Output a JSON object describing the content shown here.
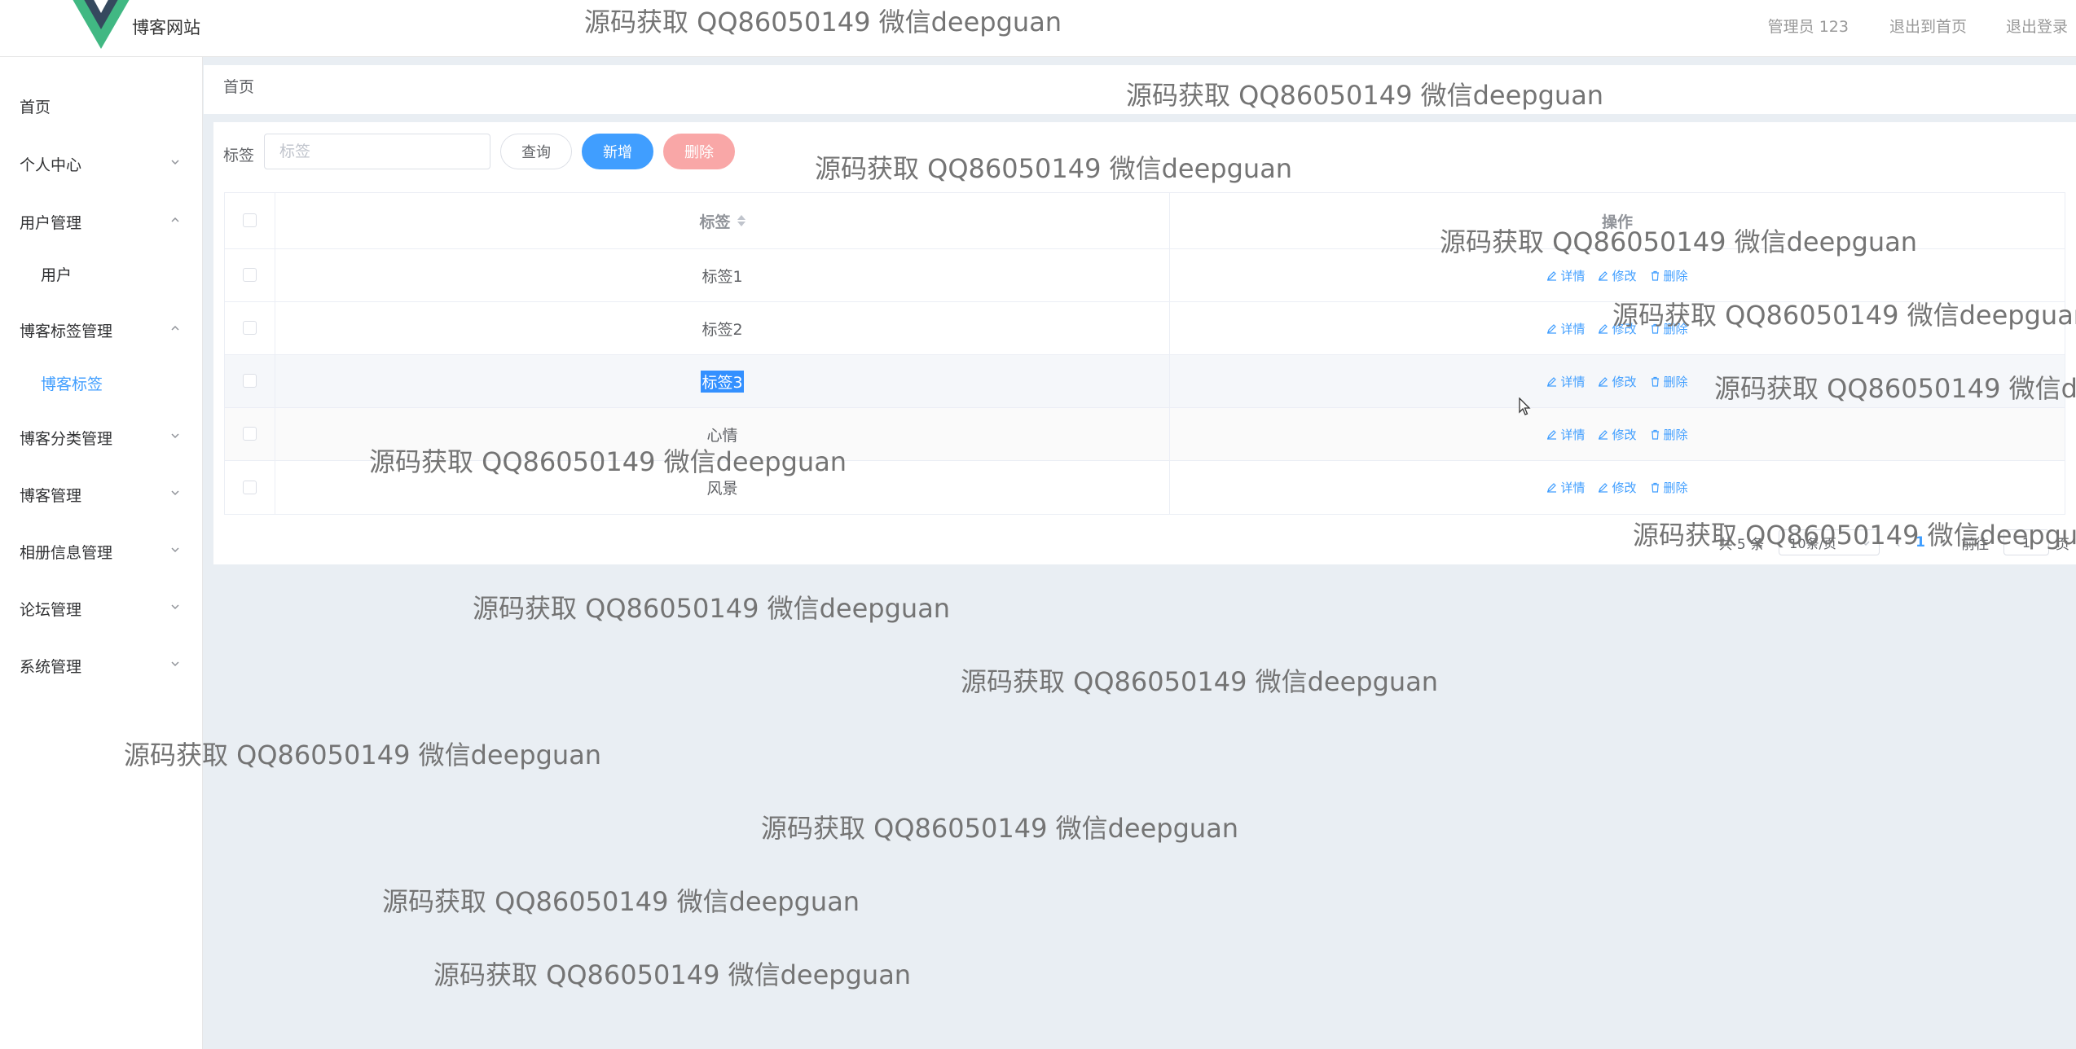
{
  "header": {
    "site_title": "博客网站",
    "user_label": "管理员 123",
    "back_home": "退出到首页",
    "logout": "退出登录",
    "accent_color": "#409eff"
  },
  "sidebar": {
    "items": [
      {
        "label": "首页"
      },
      {
        "label": "个人中心",
        "icon": "chevron-down-icon"
      },
      {
        "label": "用户管理",
        "icon": "chevron-up-icon"
      },
      {
        "label": "用户"
      },
      {
        "label": "博客标签管理",
        "icon": "chevron-up-icon"
      },
      {
        "label": "博客标签",
        "active": true
      },
      {
        "label": "博客分类管理",
        "icon": "chevron-down-icon"
      },
      {
        "label": "博客管理",
        "icon": "chevron-down-icon"
      },
      {
        "label": "相册信息管理",
        "icon": "chevron-down-icon"
      },
      {
        "label": "论坛管理",
        "icon": "chevron-down-icon"
      },
      {
        "label": "系统管理",
        "icon": "chevron-down-icon"
      }
    ]
  },
  "breadcrumb": {
    "home": "首页"
  },
  "search": {
    "label": "标签",
    "placeholder": "标签",
    "query_button": "查询",
    "add_button": "新增",
    "delete_button": "删除"
  },
  "table": {
    "headers": {
      "label": "标签",
      "ops": "操作"
    },
    "rows": [
      {
        "label": "标签1"
      },
      {
        "label": "标签2"
      },
      {
        "label": "标签3"
      },
      {
        "label": "心情"
      },
      {
        "label": "风景"
      }
    ],
    "actions": {
      "detail": "详情",
      "edit": "修改",
      "delete": "删除"
    }
  },
  "pagination": {
    "total": "共 5 条",
    "page_size": "10条/页",
    "current_page": "1",
    "goto_prefix": "前往",
    "goto_value": "1",
    "goto_suffix": "页"
  },
  "watermark": "源码获取 QQ86050149 微信deepguan"
}
